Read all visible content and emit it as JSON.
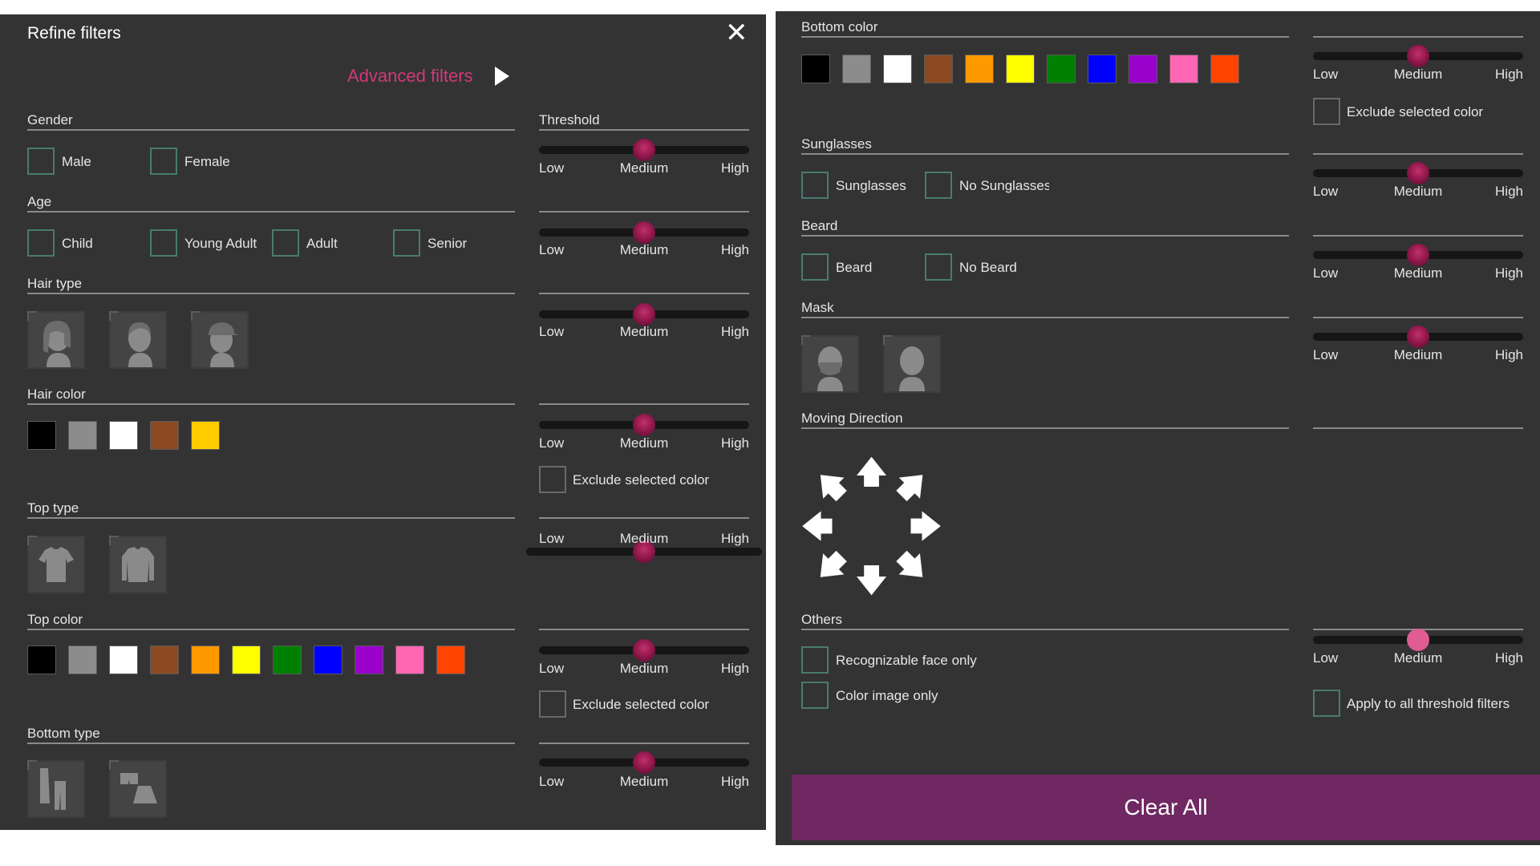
{
  "left": {
    "title": "Refine filters",
    "close_glyph": "✕",
    "advanced_filters": "Advanced filters",
    "threshold_header": "Threshold",
    "gender": {
      "label": "Gender",
      "options": [
        "Male",
        "Female"
      ]
    },
    "age": {
      "label": "Age",
      "options": [
        "Child",
        "Young Adult",
        "Adult",
        "Senior"
      ]
    },
    "hair_type": {
      "label": "Hair type",
      "icons": [
        "long-hair-icon",
        "short-hair-icon",
        "cap-icon"
      ]
    },
    "hair_color": {
      "label": "Hair color",
      "colors": [
        "#000000",
        "#8c8c8c",
        "#ffffff",
        "#8b4a22",
        "#ffcc00"
      ]
    },
    "top_type": {
      "label": "Top type",
      "icons": [
        "short-sleeve-shirt-icon",
        "long-sleeve-shirt-icon"
      ]
    },
    "top_color": {
      "label": "Top color",
      "colors": [
        "#000000",
        "#8c8c8c",
        "#ffffff",
        "#8b4a22",
        "#ff9900",
        "#ffff00",
        "#008000",
        "#0000ff",
        "#9900cc",
        "#ff66b3",
        "#ff4400"
      ]
    },
    "bottom_type": {
      "label": "Bottom type",
      "icons": [
        "trousers-icon",
        "shorts-skirt-icon"
      ]
    },
    "exclude_label": "Exclude selected color"
  },
  "right": {
    "bottom_color": {
      "label": "Bottom color",
      "colors": [
        "#000000",
        "#8c8c8c",
        "#ffffff",
        "#8b4a22",
        "#ff9900",
        "#ffff00",
        "#008000",
        "#0000ff",
        "#9900cc",
        "#ff66b3",
        "#ff4400"
      ]
    },
    "sunglasses": {
      "label": "Sunglasses",
      "options": [
        "Sunglasses",
        "No Sunglasses"
      ]
    },
    "beard": {
      "label": "Beard",
      "options": [
        "Beard",
        "No Beard"
      ]
    },
    "mask": {
      "label": "Mask",
      "icons": [
        "masked-face-icon",
        "unmasked-face-icon"
      ]
    },
    "moving_direction": {
      "label": "Moving Direction"
    },
    "others": {
      "label": "Others",
      "options": [
        "Recognizable face only",
        "Color image only"
      ]
    },
    "exclude_label": "Exclude selected color",
    "apply_all_label": "Apply to all threshold filters",
    "clear_all": "Clear All"
  },
  "slider": {
    "low": "Low",
    "medium": "Medium",
    "high": "High",
    "value": 0.5
  },
  "colors": {
    "panel_bg": "#333333",
    "accent": "#d03a7a",
    "clear_button": "#6f2862",
    "checkbox_border": "#4a7a70"
  }
}
